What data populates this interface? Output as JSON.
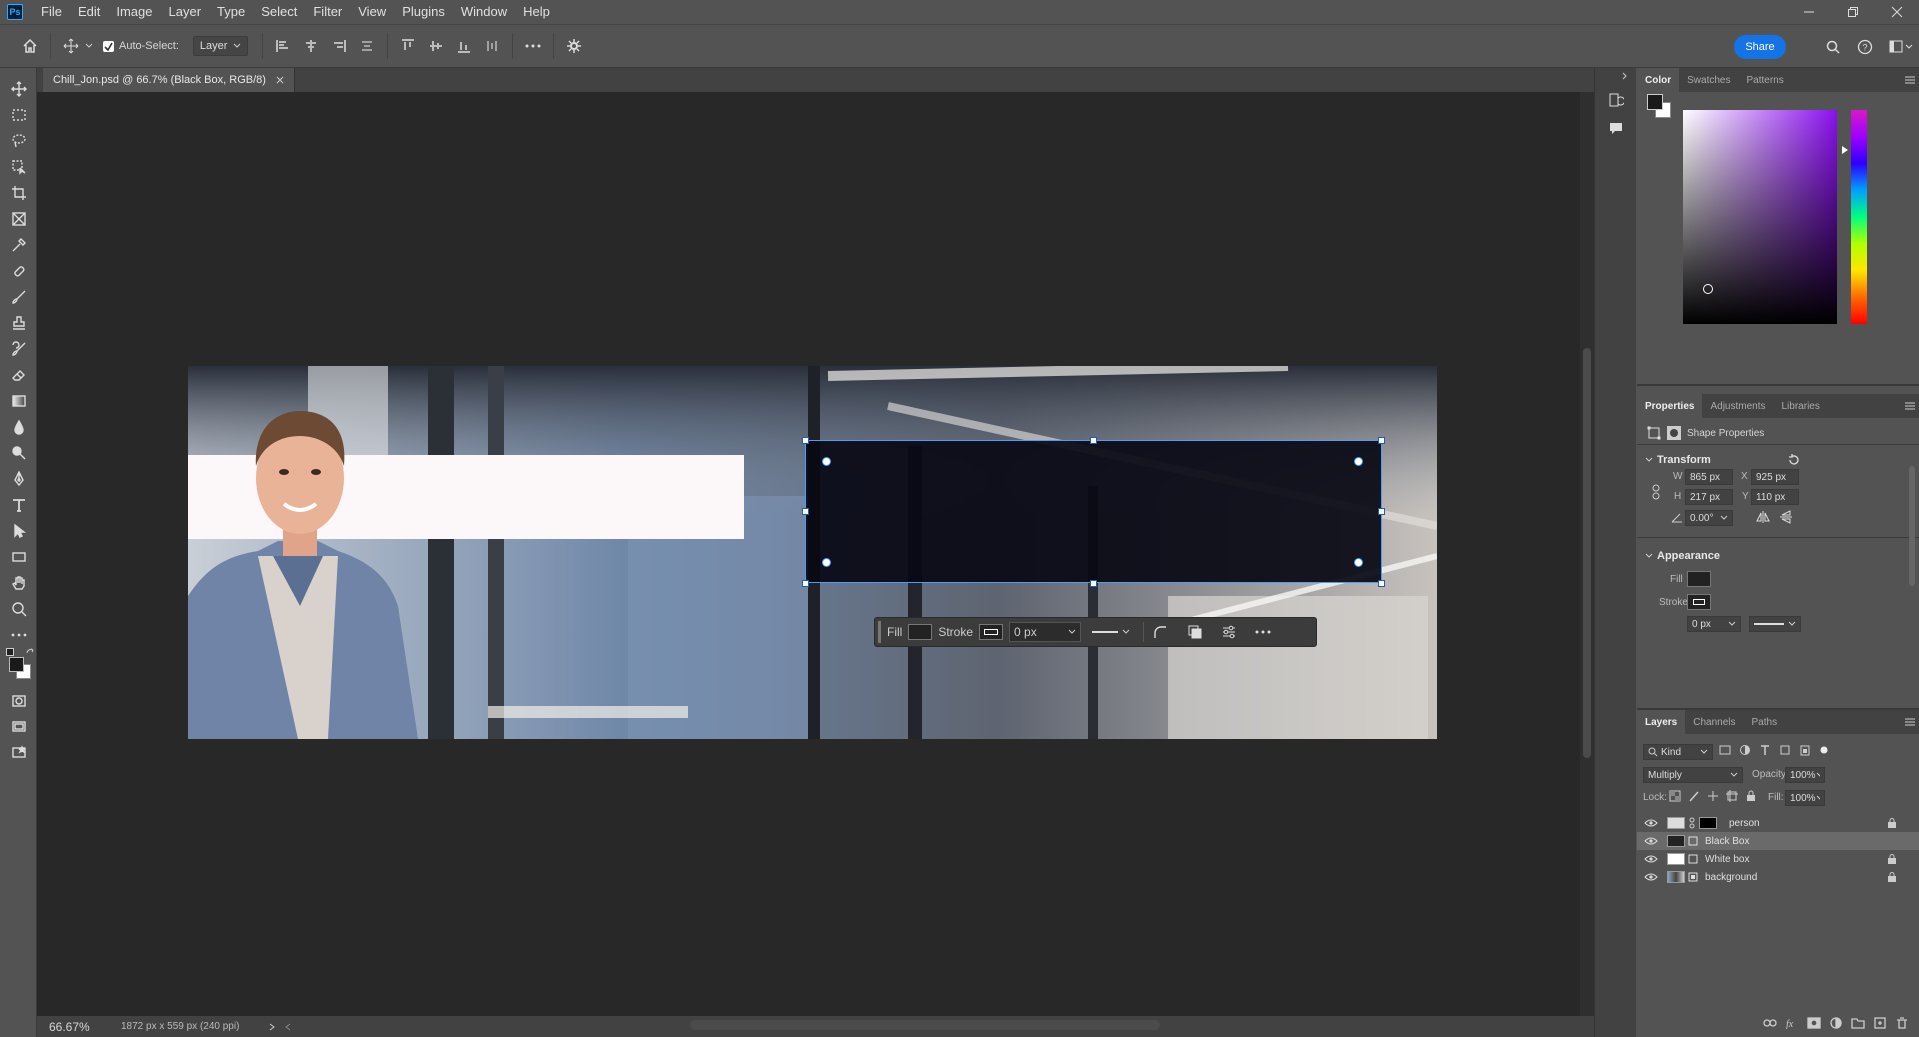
{
  "app": {
    "logo": "Ps"
  },
  "menu": [
    "File",
    "Edit",
    "Image",
    "Layer",
    "Type",
    "Select",
    "Filter",
    "View",
    "Plugins",
    "Window",
    "Help"
  ],
  "options_bar": {
    "auto_select_label": "Auto-Select:",
    "auto_select_value": "Layer",
    "share_label": "Share"
  },
  "document": {
    "tab_title": "Chill_Jon.psd @ 66.7% (Black Box, RGB/8)",
    "zoom": "66.67%",
    "doc_info": "1872 px x 559 px (240 ppi)"
  },
  "context_bar": {
    "fill_label": "Fill",
    "stroke_label": "Stroke",
    "stroke_width": "0 px"
  },
  "color_panel": {
    "tabs": [
      "Color",
      "Swatches",
      "Patterns"
    ],
    "foreground": "#1a1a1a",
    "background": "#ffffff"
  },
  "properties_panel": {
    "tabs": [
      "Properties",
      "Adjustments",
      "Libraries"
    ],
    "title": "Shape Properties",
    "transform": {
      "label": "Transform",
      "w_label": "W",
      "w": "865 px",
      "h_label": "H",
      "h": "217 px",
      "x_label": "X",
      "x": "925 px",
      "y_label": "Y",
      "y": "110 px",
      "angle": "0.00°"
    },
    "appearance": {
      "label": "Appearance",
      "fill_label": "Fill",
      "stroke_label": "Stroke",
      "stroke_width": "0 px"
    }
  },
  "layers_panel": {
    "tabs": [
      "Layers",
      "Channels",
      "Paths"
    ],
    "filter_kind": "Kind",
    "blend_mode": "Multiply",
    "opacity_label": "Opacity:",
    "opacity": "100%",
    "lock_label": "Lock:",
    "fill_label": "Fill:",
    "fill": "100%",
    "layers": [
      {
        "name": "person",
        "selected": false,
        "locked": true
      },
      {
        "name": "Black Box",
        "selected": true,
        "locked": false
      },
      {
        "name": "White box",
        "selected": false,
        "locked": true
      },
      {
        "name": "background",
        "selected": false,
        "locked": true
      }
    ]
  },
  "colors": {
    "accent": "#1473e6",
    "selection": "#4a9cff",
    "white_box": "#fcf8f9",
    "black_box": "#090914"
  }
}
